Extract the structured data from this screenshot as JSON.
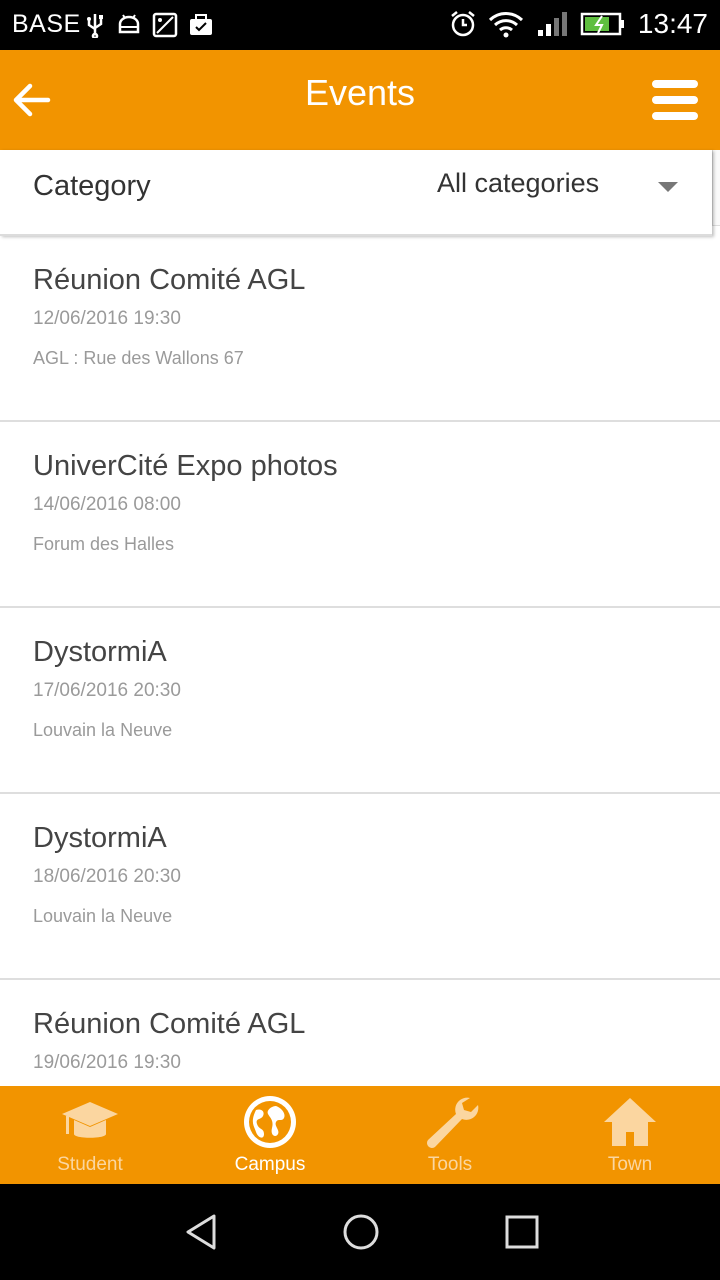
{
  "status_bar": {
    "carrier": "BASE",
    "time": "13:47"
  },
  "app_bar": {
    "title": "Events"
  },
  "filter": {
    "label": "Category",
    "selected": "All categories"
  },
  "events": [
    {
      "name": "Réunion Comité AGL",
      "datetime": "12/06/2016 19:30",
      "location": "AGL : Rue des Wallons 67"
    },
    {
      "name": "UniverCité Expo photos",
      "datetime": "14/06/2016 08:00",
      "location": "Forum des Halles"
    },
    {
      "name": "DystormiA",
      "datetime": "17/06/2016 20:30",
      "location": "Louvain la Neuve"
    },
    {
      "name": "DystormiA",
      "datetime": "18/06/2016 20:30",
      "location": "Louvain la Neuve"
    },
    {
      "name": "Réunion Comité AGL",
      "datetime": "19/06/2016 19:30",
      "location": ""
    }
  ],
  "tabs": [
    {
      "label": "Student",
      "icon": "graduation-cap-icon",
      "active": false
    },
    {
      "label": "Campus",
      "icon": "globe-icon",
      "active": true
    },
    {
      "label": "Tools",
      "icon": "wrench-icon",
      "active": false
    },
    {
      "label": "Town",
      "icon": "house-icon",
      "active": false
    }
  ],
  "colors": {
    "accent": "#f29400",
    "tab_inactive": "#fbd6a0"
  }
}
